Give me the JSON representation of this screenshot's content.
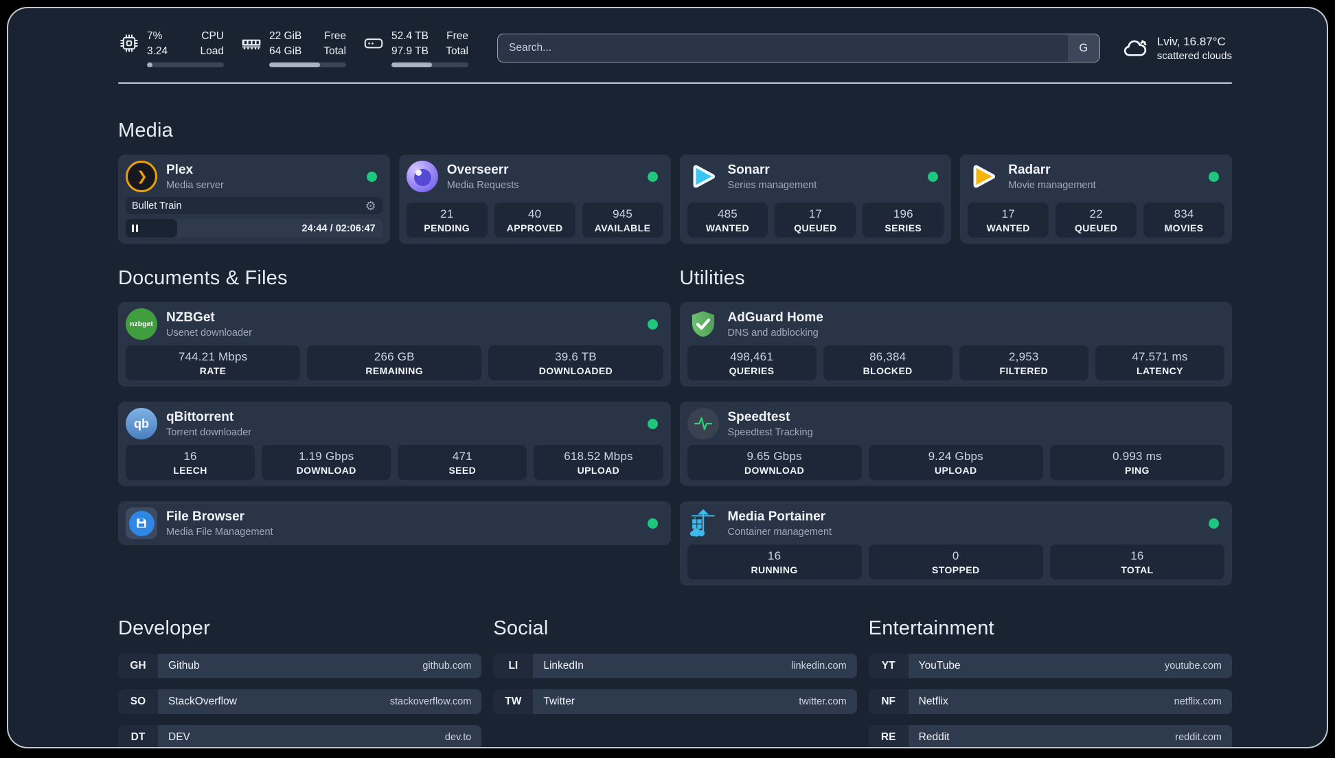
{
  "header": {
    "system": [
      {
        "value1": "7%",
        "value2": "3.24",
        "label1": "CPU",
        "label2": "Load",
        "progress_pct": 7
      },
      {
        "value1": "22 GiB",
        "value2": "64 GiB",
        "label1": "Free",
        "label2": "Total",
        "progress_pct": 66
      },
      {
        "value1": "52.4 TB",
        "value2": "97.9 TB",
        "label1": "Free",
        "label2": "Total",
        "progress_pct": 53
      }
    ],
    "search": {
      "placeholder": "Search...",
      "engine_button": "G"
    },
    "weather": {
      "location": "Lviv, 16.87°C",
      "condition": "scattered clouds"
    }
  },
  "icons": {
    "settings_glyph": "⚙",
    "plex_glyph": "❯",
    "nzbget_text": "nzbget",
    "qbittorrent_text": "qb"
  },
  "sections": {
    "media": {
      "title": "Media",
      "plex": {
        "title": "Plex",
        "subtitle": "Media server",
        "now_playing": "Bullet Train",
        "time": "24:44 / 02:06:47",
        "progress_pct": 20
      },
      "overseerr": {
        "title": "Overseerr",
        "subtitle": "Media Requests",
        "stats": [
          {
            "value": "21",
            "label": "PENDING"
          },
          {
            "value": "40",
            "label": "APPROVED"
          },
          {
            "value": "945",
            "label": "AVAILABLE"
          }
        ]
      },
      "sonarr": {
        "title": "Sonarr",
        "subtitle": "Series management",
        "stats": [
          {
            "value": "485",
            "label": "WANTED"
          },
          {
            "value": "17",
            "label": "QUEUED"
          },
          {
            "value": "196",
            "label": "SERIES"
          }
        ]
      },
      "radarr": {
        "title": "Radarr",
        "subtitle": "Movie management",
        "stats": [
          {
            "value": "17",
            "label": "WANTED"
          },
          {
            "value": "22",
            "label": "QUEUED"
          },
          {
            "value": "834",
            "label": "MOVIES"
          }
        ]
      }
    },
    "documents": {
      "title": "Documents & Files",
      "nzbget": {
        "title": "NZBGet",
        "subtitle": "Usenet downloader",
        "stats": [
          {
            "value": "744.21 Mbps",
            "label": "RATE"
          },
          {
            "value": "266 GB",
            "label": "REMAINING"
          },
          {
            "value": "39.6 TB",
            "label": "DOWNLOADED"
          }
        ]
      },
      "qbittorrent": {
        "title": "qBittorrent",
        "subtitle": "Torrent downloader",
        "stats": [
          {
            "value": "16",
            "label": "LEECH"
          },
          {
            "value": "1.19 Gbps",
            "label": "DOWNLOAD"
          },
          {
            "value": "471",
            "label": "SEED"
          },
          {
            "value": "618.52 Mbps",
            "label": "UPLOAD"
          }
        ]
      },
      "filebrowser": {
        "title": "File Browser",
        "subtitle": "Media File Management"
      }
    },
    "utilities": {
      "title": "Utilities",
      "adguard": {
        "title": "AdGuard Home",
        "subtitle": "DNS and adblocking",
        "stats": [
          {
            "value": "498,461",
            "label": "QUERIES"
          },
          {
            "value": "86,384",
            "label": "BLOCKED"
          },
          {
            "value": "2,953",
            "label": "FILTERED"
          },
          {
            "value": "47.571 ms",
            "label": "LATENCY"
          }
        ]
      },
      "speedtest": {
        "title": "Speedtest",
        "subtitle": "Speedtest Tracking",
        "stats": [
          {
            "value": "9.65 Gbps",
            "label": "DOWNLOAD"
          },
          {
            "value": "9.24 Gbps",
            "label": "UPLOAD"
          },
          {
            "value": "0.993 ms",
            "label": "PING"
          }
        ]
      },
      "portainer": {
        "title": "Media Portainer",
        "subtitle": "Container management",
        "stats": [
          {
            "value": "16",
            "label": "RUNNING"
          },
          {
            "value": "0",
            "label": "STOPPED"
          },
          {
            "value": "16",
            "label": "TOTAL"
          }
        ]
      }
    },
    "links": {
      "developer": {
        "title": "Developer",
        "items": [
          {
            "abbr": "GH",
            "name": "Github",
            "url": "github.com"
          },
          {
            "abbr": "SO",
            "name": "StackOverflow",
            "url": "stackoverflow.com"
          },
          {
            "abbr": "DT",
            "name": "DEV",
            "url": "dev.to"
          }
        ]
      },
      "social": {
        "title": "Social",
        "items": [
          {
            "abbr": "LI",
            "name": "LinkedIn",
            "url": "linkedin.com"
          },
          {
            "abbr": "TW",
            "name": "Twitter",
            "url": "twitter.com"
          }
        ]
      },
      "entertainment": {
        "title": "Entertainment",
        "items": [
          {
            "abbr": "YT",
            "name": "YouTube",
            "url": "youtube.com"
          },
          {
            "abbr": "NF",
            "name": "Netflix",
            "url": "netflix.com"
          },
          {
            "abbr": "RE",
            "name": "Reddit",
            "url": "reddit.com"
          }
        ]
      }
    }
  },
  "colors": {
    "status_online": "#1fc77e",
    "page_bg": "#1a2332",
    "card_bg": "#2a3447",
    "tile_bg": "#1e2738",
    "plex_accent": "#e8a00c"
  }
}
